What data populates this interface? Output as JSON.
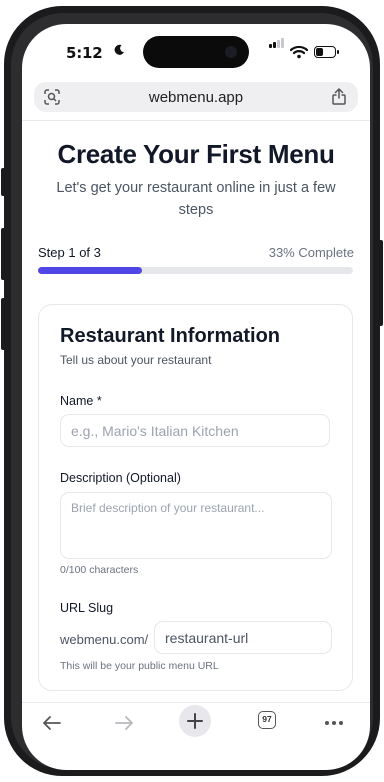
{
  "status_bar": {
    "time": "5:12"
  },
  "browser": {
    "url": "webmenu.app",
    "tab_count": "97"
  },
  "page": {
    "title": "Create Your First Menu",
    "subtitle": "Let's get your restaurant online in just a few steps",
    "progress": {
      "step_label": "Step 1 of 3",
      "percent_label": "33% Complete",
      "fraction": 0.33
    },
    "card": {
      "title": "Restaurant Information",
      "subtitle": "Tell us about your restaurant",
      "name": {
        "label": "Name *",
        "value": "",
        "placeholder": "e.g., Mario's Italian Kitchen"
      },
      "description": {
        "label": "Description (Optional)",
        "value": "",
        "placeholder": "Brief description of your restaurant...",
        "counter": "0/100 characters"
      },
      "slug": {
        "label": "URL Slug",
        "prefix": "webmenu.com/",
        "value": "",
        "placeholder": "restaurant-url",
        "hint": "This will be your public menu URL"
      }
    }
  },
  "colors": {
    "accent": "#4f46e5",
    "track": "#e5e7eb",
    "text_primary": "#111827",
    "text_secondary": "#4b5563",
    "muted": "#9ca3af"
  },
  "icons": {
    "status": [
      "moon-icon",
      "cellular-signal-icon",
      "wifi-icon",
      "battery-icon"
    ],
    "url_bar": [
      "reader-scan-icon",
      "share-icon"
    ],
    "toolbar": [
      "back-arrow-icon",
      "forward-arrow-icon",
      "new-tab-plus-icon",
      "tabs-icon",
      "more-icon"
    ]
  }
}
